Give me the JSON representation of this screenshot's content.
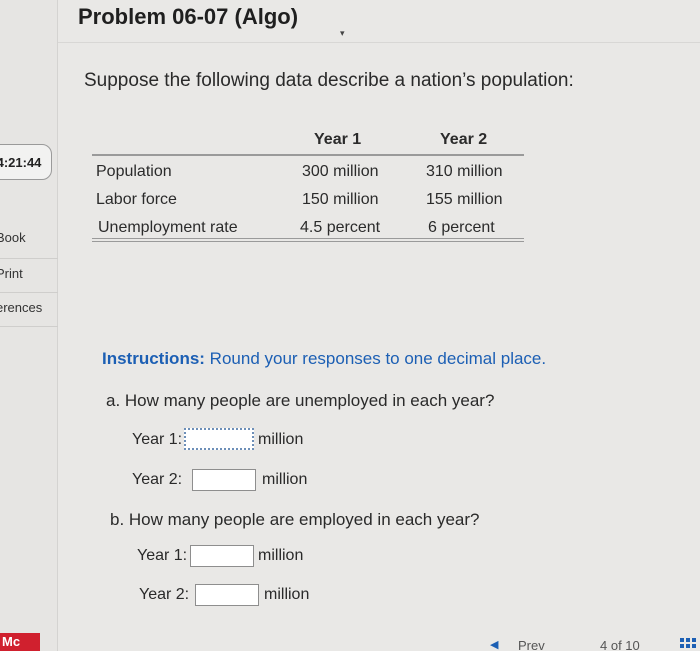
{
  "sidebar": {
    "timer": "4:21:44",
    "links": [
      "Book",
      "Print",
      "erences"
    ],
    "brand": "Mc"
  },
  "problem": {
    "title": "Problem 06-07 (Algo)",
    "intro": "Suppose the following data describe a nation’s population:"
  },
  "table": {
    "headers": [
      "Year 1",
      "Year 2"
    ],
    "rows": [
      {
        "label": "Population",
        "y1": "300 million",
        "y2": "310 million"
      },
      {
        "label": "Labor force",
        "y1": "150 million",
        "y2": "155 million"
      },
      {
        "label": "Unemployment rate",
        "y1": "4.5 percent",
        "y2": "6 percent"
      }
    ]
  },
  "instructions": {
    "bold": "Instructions:",
    "text": " Round your responses to one decimal place."
  },
  "questions": {
    "a": "a. How many people are unemployed in each year?",
    "b": "b. How many people are employed in each year?",
    "year1_label": "Year 1:",
    "year2_label": "Year 2:",
    "unit": "million",
    "a_year1_value": "",
    "a_year2_value": "",
    "b_year1_value": "",
    "b_year2_value": ""
  },
  "nav": {
    "prev": "Prev",
    "pager": "4 of 10"
  },
  "colors": {
    "accent": "#1c5fb4",
    "brand": "#d0202e"
  }
}
